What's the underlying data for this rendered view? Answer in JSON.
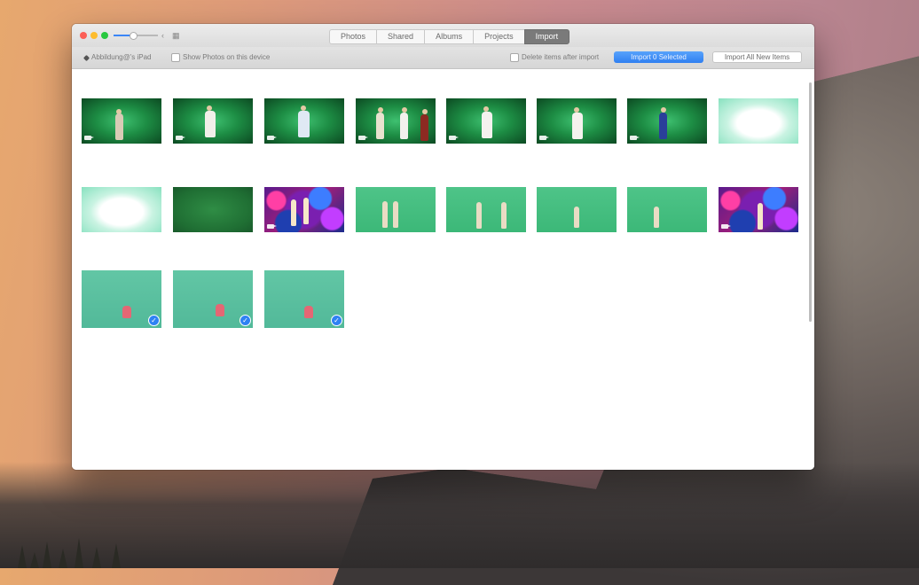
{
  "window": {
    "tabs": [
      "Photos",
      "Shared",
      "Albums",
      "Projects",
      "Import"
    ],
    "active_tab": "Import"
  },
  "toolbar": {
    "import_to_label": "Abbildung@'s iPad",
    "show_photos_label": "Show Photos on this device",
    "delete_label": "Delete items after import",
    "import_selected_label": "Import 0 Selected",
    "import_all_label": "Import All New Items"
  },
  "colors": {
    "accent": "#2f7ff1",
    "close": "#fc5f57",
    "minimize": "#fdbc2e",
    "zoom": "#28c840"
  },
  "thumbnails": [
    {
      "kind": "video",
      "style": "green-dark",
      "subject": "one person"
    },
    {
      "kind": "video",
      "style": "green-dark",
      "subject": "one person"
    },
    {
      "kind": "video",
      "style": "green-dark",
      "subject": "one person"
    },
    {
      "kind": "video",
      "style": "green-dark",
      "subject": "three people"
    },
    {
      "kind": "video",
      "style": "green-dark",
      "subject": "one person"
    },
    {
      "kind": "video",
      "style": "green-dark",
      "subject": "one person"
    },
    {
      "kind": "video",
      "style": "green-dark",
      "subject": "one person"
    },
    {
      "kind": "photo",
      "style": "flare",
      "subject": "bright flare"
    },
    {
      "kind": "photo",
      "style": "flare",
      "subject": "bright flare"
    },
    {
      "kind": "photo",
      "style": "plain-dark",
      "subject": "empty green screen"
    },
    {
      "kind": "video",
      "style": "party",
      "subject": "colorful lights"
    },
    {
      "kind": "photo",
      "style": "green-mid",
      "subject": "two people"
    },
    {
      "kind": "photo",
      "style": "green-mid",
      "subject": "two people"
    },
    {
      "kind": "photo",
      "style": "green-mid",
      "subject": "one person"
    },
    {
      "kind": "photo",
      "style": "green-mid",
      "subject": "one person"
    },
    {
      "kind": "video",
      "style": "party",
      "subject": "colorful lights"
    },
    {
      "kind": "photo",
      "style": "teal",
      "subject": "pink toy",
      "imported": true
    },
    {
      "kind": "photo",
      "style": "teal",
      "subject": "pink toy",
      "imported": true
    },
    {
      "kind": "photo",
      "style": "teal",
      "subject": "pink toy",
      "imported": true
    }
  ],
  "icons": {
    "close": "close-dot-icon",
    "minimize": "minimize-dot-icon",
    "zoom": "zoom-dot-icon",
    "imported_badge": "checkmark-icon",
    "video": "video-camera-icon"
  }
}
